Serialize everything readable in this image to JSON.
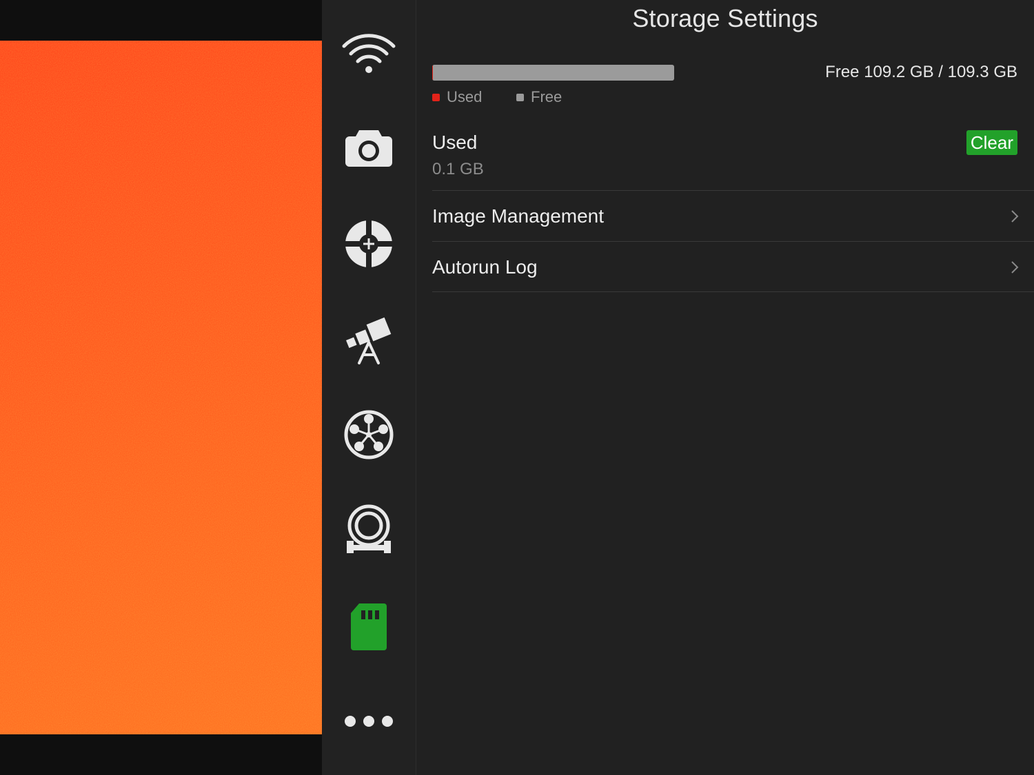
{
  "header": {
    "title": "Storage Settings"
  },
  "storage": {
    "summary_text": "Free 109.2 GB / 109.3 GB",
    "used_fraction": 0.001,
    "legend": {
      "used_label": "Used",
      "free_label": "Free"
    },
    "used_section": {
      "label": "Used",
      "value": "0.1 GB",
      "clear_label": "Clear"
    }
  },
  "menu": {
    "items": [
      {
        "label": "Image Management"
      },
      {
        "label": "Autorun Log"
      }
    ]
  },
  "sidebar": {
    "items": [
      {
        "icon": "wifi-icon",
        "active": false
      },
      {
        "icon": "camera-icon",
        "active": false
      },
      {
        "icon": "focus-target-icon",
        "active": false
      },
      {
        "icon": "telescope-icon",
        "active": false
      },
      {
        "icon": "filter-wheel-icon",
        "active": false
      },
      {
        "icon": "focuser-icon",
        "active": false
      },
      {
        "icon": "sd-card-icon",
        "active": true
      },
      {
        "icon": "more-icon",
        "active": false
      }
    ]
  },
  "colors": {
    "accent_green": "#22a12a",
    "used_red": "#e2231a",
    "free_gray": "#9b9b9b",
    "icon_default": "#e8e8e8"
  }
}
